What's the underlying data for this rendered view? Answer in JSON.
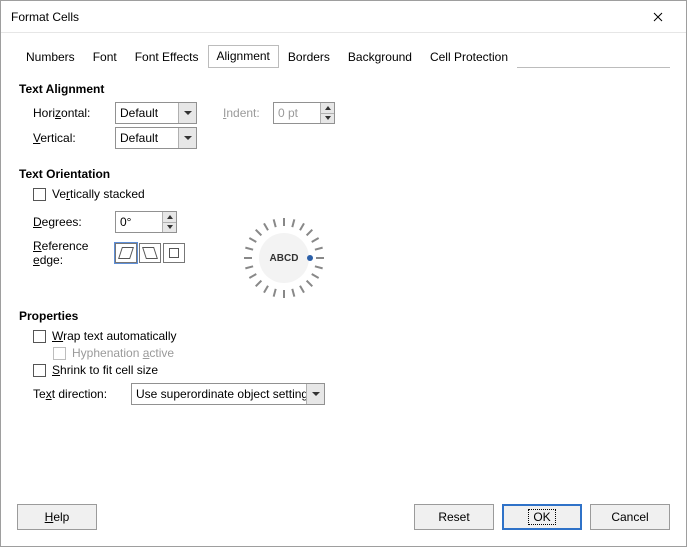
{
  "window": {
    "title": "Format Cells"
  },
  "tabs": {
    "numbers": "Numbers",
    "font": "Font",
    "font_effects": "Font Effects",
    "alignment": "Alignment",
    "borders": "Borders",
    "background": "Background",
    "cell_protection": "Cell Protection"
  },
  "alignment": {
    "section_text_alignment": "Text Alignment",
    "horizontal_label": "Horizontal:",
    "horizontal_value": "Default",
    "indent_label": "Indent:",
    "indent_value": "0 pt",
    "vertical_label": "Vertical:",
    "vertical_value": "Default"
  },
  "orientation": {
    "section": "Text Orientation",
    "vertically_stacked": "Vertically stacked",
    "degrees_label": "Degrees:",
    "degrees_value": "0°",
    "reference_edge_label": "Reference edge:",
    "dial_text": "ABCD"
  },
  "properties": {
    "section": "Properties",
    "wrap": "Wrap text automatically",
    "hyphenation": "Hyphenation active",
    "shrink": "Shrink to fit cell size",
    "text_direction_label": "Text direction:",
    "text_direction_value": "Use superordinate object settings"
  },
  "buttons": {
    "help": "Help",
    "reset": "Reset",
    "ok": "OK",
    "cancel": "Cancel"
  }
}
